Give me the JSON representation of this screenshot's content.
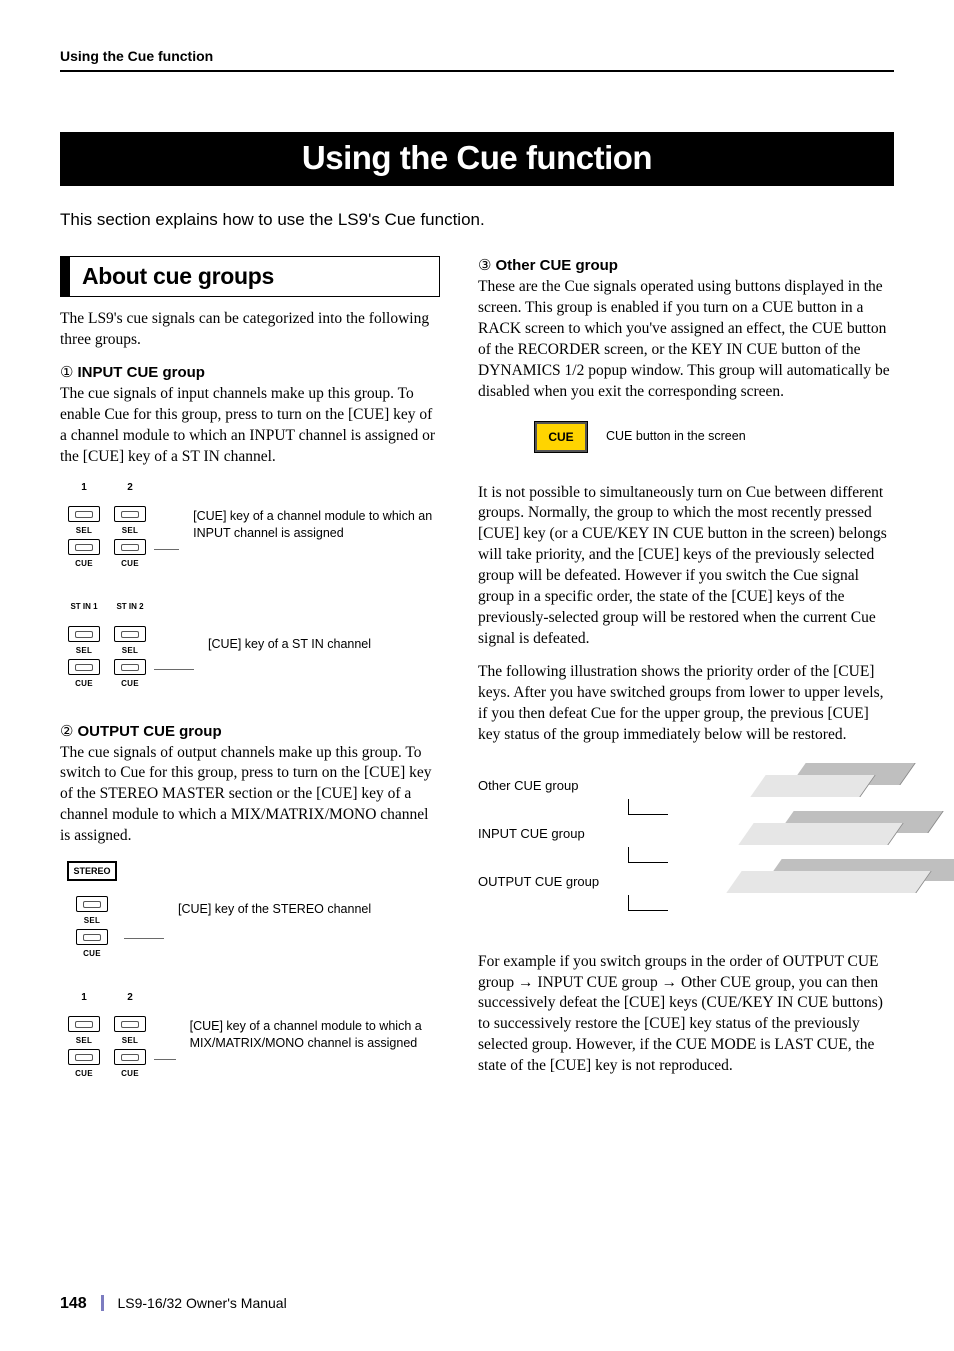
{
  "running_head": "Using the Cue function",
  "banner": "Using the Cue function",
  "intro": "This section explains how to use the LS9's Cue function.",
  "left": {
    "section_head": "About cue groups",
    "intro": "The LS9's cue signals can be categorized into the following three groups.",
    "g1_head_num": "①",
    "g1_head": "INPUT CUE group",
    "g1_body": "The cue signals of input channels make up this group. To enable Cue for this group, press to turn on the [CUE] key of a channel module to which an INPUT channel is assigned or the [CUE] key of a ST IN channel.",
    "g1_cap1": "[CUE] key of a channel module to which an INPUT channel is assigned",
    "g1_cap2": "[CUE] key of a ST IN channel",
    "g2_head_num": "②",
    "g2_head": "OUTPUT CUE group",
    "g2_body": "The cue signals of output channels make up this group. To switch to Cue for this group, press to turn on the [CUE] key of the STEREO MASTER section or the [CUE] key of a channel module to which a MIX/MATRIX/MONO channel is assigned.",
    "g2_cap1": "[CUE] key of the STEREO channel",
    "g2_cap2": "[CUE] key of a channel module to which a MIX/MATRIX/MONO channel is assigned",
    "ch_labels": {
      "n1": "1",
      "n2": "2",
      "stin1": "ST IN 1",
      "stin2": "ST IN 2",
      "sel": "SEL",
      "cue": "CUE",
      "stereo": "STEREO"
    }
  },
  "right": {
    "g3_head_num": "③",
    "g3_head": "Other CUE group",
    "g3_body": "These are the Cue signals operated using buttons displayed in the screen. This group is enabled if you turn on a CUE button in a RACK screen to which you've assigned an effect, the CUE button of the RECORDER screen, or the KEY IN CUE button of the DYNAMICS 1/2 popup window. This group will automatically be disabled when you exit the corresponding screen.",
    "cue_btn_text": "CUE",
    "cue_btn_caption": "CUE button in the screen",
    "p1": "It is not possible to simultaneously turn on Cue between different groups. Normally, the group to which the most recently pressed [CUE] key (or a CUE/KEY IN CUE button in the screen) belongs will take priority, and the [CUE] keys of the previously selected group will be defeated. However if you switch the Cue signal group in a specific order, the state of the [CUE] keys of the previously-selected group will be restored when the current Cue signal is defeated.",
    "p2": "The following illustration shows the priority order of the [CUE] keys. After you have switched groups from lower to upper levels, if you then defeat Cue for the upper group, the previous [CUE] key status of the group immediately below will be restored.",
    "pri1": "Other CUE group",
    "pri2": "INPUT CUE group",
    "pri3": "OUTPUT CUE group",
    "p3a": "For example if you switch groups in the order of OUTPUT CUE group ",
    "p3b": " INPUT CUE group ",
    "p3c": " Other CUE group, you can then successively defeat the [CUE] keys (CUE/KEY IN CUE buttons) to successively restore the [CUE] key status of the previously selected group. However, if the CUE MODE is LAST CUE, the state of the [CUE] key is not reproduced.",
    "arrow": "→"
  },
  "footer": {
    "page": "148",
    "manual": "LS9-16/32  Owner's Manual"
  }
}
